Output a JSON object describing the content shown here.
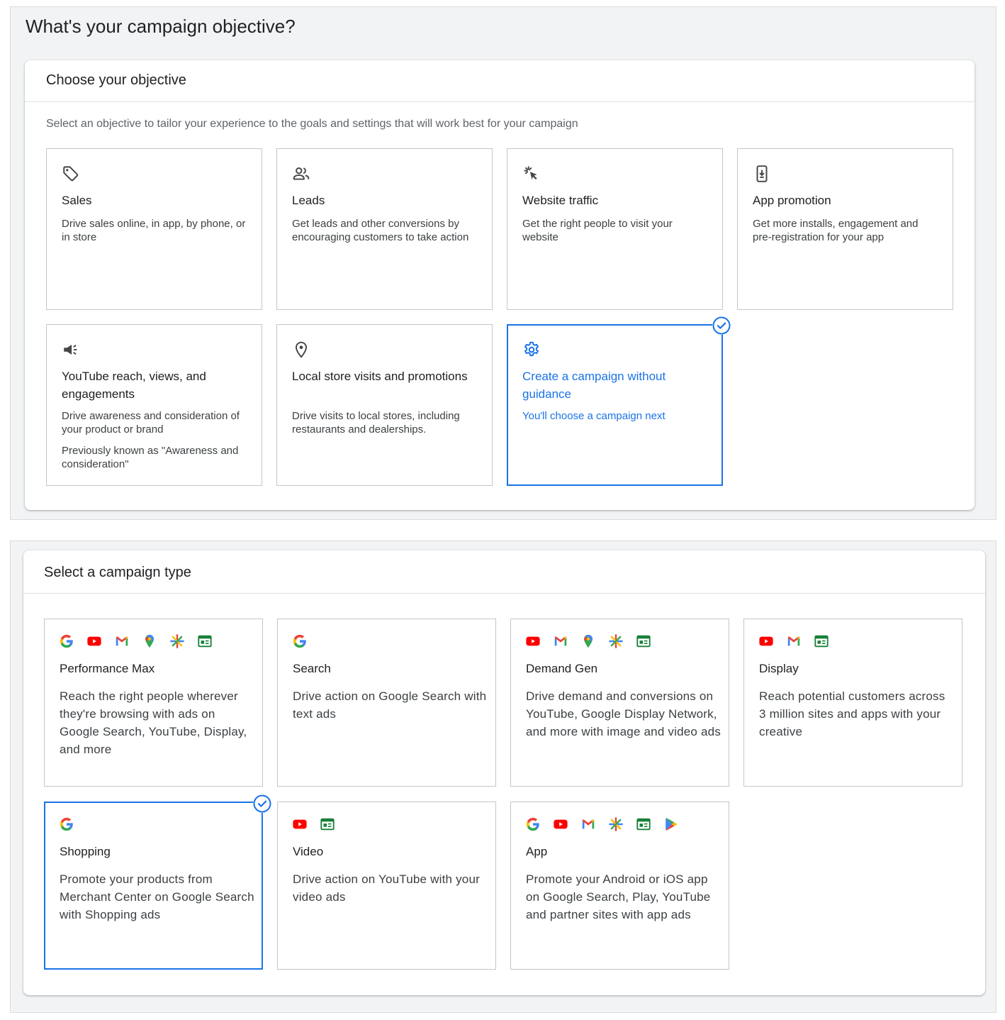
{
  "page_title": "What's your campaign objective?",
  "objective_card": {
    "title": "Choose your objective",
    "subtitle": "Select an objective to tailor your experience to the goals and settings that will work best for your campaign",
    "options": [
      {
        "icon": "tag-icon",
        "title": "Sales",
        "description": "Drive sales online, in app, by phone, or in store"
      },
      {
        "icon": "people-icon",
        "title": "Leads",
        "description": "Get leads and other conversions by encouraging customers to take action"
      },
      {
        "icon": "cursor-click-icon",
        "title": "Website traffic",
        "description": "Get the right people to visit your website"
      },
      {
        "icon": "phone-download-icon",
        "title": "App promotion",
        "description": "Get more installs, engagement and pre-registration for your app"
      },
      {
        "icon": "megaphone-icon",
        "title": "YouTube reach, views, and engagements",
        "description": "Drive awareness and consideration of your product or brand",
        "note": "Previously known as \"Awareness and consideration\""
      },
      {
        "icon": "location-pin-icon",
        "title": "Local store visits and promotions",
        "description": "Drive visits to local stores, including restaurants and dealerships."
      },
      {
        "icon": "gear-icon",
        "title": "Create a campaign without guidance",
        "description": "You'll choose a campaign next",
        "selected": true
      }
    ]
  },
  "campaign_type_card": {
    "title": "Select a campaign type",
    "options": [
      {
        "title": "Performance Max",
        "description": "Reach the right people wherever they're browsing with ads on Google Search, YouTube, Display, and more",
        "icons": [
          "google-icon",
          "youtube-icon",
          "gmail-icon",
          "maps-icon",
          "discover-icon",
          "display-icon"
        ]
      },
      {
        "title": "Search",
        "description": "Drive action on Google Search with text ads",
        "icons": [
          "google-icon"
        ]
      },
      {
        "title": "Demand Gen",
        "description": "Drive demand and conversions on YouTube, Google Display Network, and more with image and video ads",
        "icons": [
          "youtube-icon",
          "gmail-icon",
          "maps-icon",
          "discover-icon",
          "display-icon"
        ]
      },
      {
        "title": "Display",
        "description": "Reach potential customers across 3 million sites and apps with your creative",
        "icons": [
          "youtube-icon",
          "gmail-icon",
          "display-icon"
        ]
      },
      {
        "title": "Shopping",
        "description": "Promote your products from Merchant Center on Google Search with Shopping ads",
        "icons": [
          "google-icon"
        ],
        "selected": true
      },
      {
        "title": "Video",
        "description": "Drive action on YouTube with your video ads",
        "icons": [
          "youtube-icon",
          "display-icon"
        ]
      },
      {
        "title": "App",
        "description": "Promote your Android or iOS app on Google Search, Play, YouTube and partner sites with app ads",
        "icons": [
          "google-icon",
          "youtube-icon",
          "gmail-icon",
          "discover-icon",
          "display-icon",
          "google-play-icon"
        ]
      }
    ]
  },
  "colors": {
    "accent": "#1a73e8",
    "google_blue": "#4285f4",
    "google_red": "#ea4335",
    "google_yellow": "#fbbc04",
    "google_green": "#34a853",
    "youtube_red": "#ff0000"
  }
}
